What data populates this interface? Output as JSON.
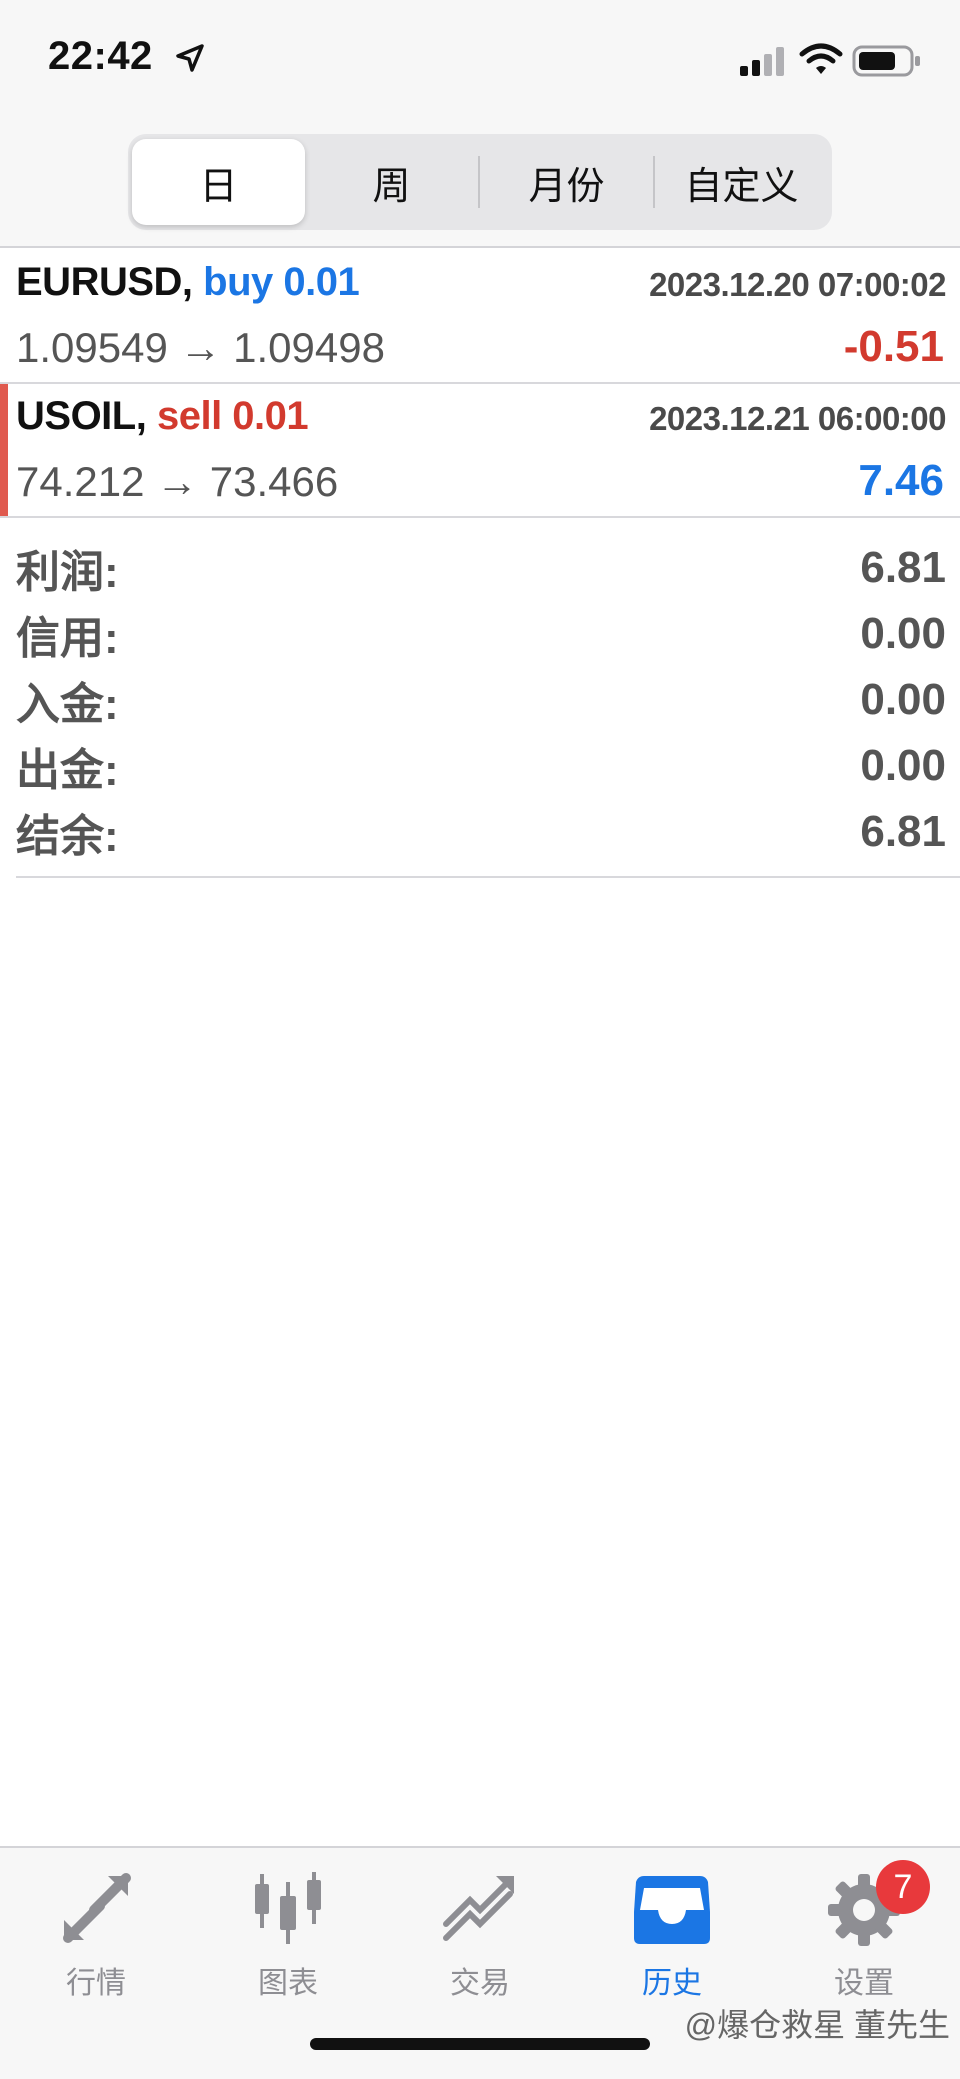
{
  "status_bar": {
    "time": "22:42"
  },
  "segments": [
    {
      "label": "日",
      "active": true
    },
    {
      "label": "周",
      "active": false
    },
    {
      "label": "月份",
      "active": false
    },
    {
      "label": "自定义",
      "active": false
    }
  ],
  "trades": [
    {
      "symbol": "EURUSD,",
      "side": "buy 0.01",
      "time": "2023.12.20 07:00:02",
      "prices": "1.09549 → 1.09498",
      "profit": "-0.51"
    },
    {
      "symbol": "USOIL,",
      "side": "sell 0.01",
      "time": "2023.12.21 06:00:00",
      "prices": "74.212 → 73.466",
      "profit": "7.46"
    }
  ],
  "summary": [
    {
      "label": "利润:",
      "value": "6.81"
    },
    {
      "label": "信用:",
      "value": "0.00"
    },
    {
      "label": "入金:",
      "value": "0.00"
    },
    {
      "label": "出金:",
      "value": "0.00"
    },
    {
      "label": "结余:",
      "value": "6.81"
    }
  ],
  "tabs": [
    {
      "label": "行情",
      "icon": "quotes-arrows-icon"
    },
    {
      "label": "图表",
      "icon": "candlestick-chart-icon"
    },
    {
      "label": "交易",
      "icon": "trade-trend-icon"
    },
    {
      "label": "历史",
      "icon": "history-inbox-icon",
      "active": true
    },
    {
      "label": "设置",
      "icon": "gear-icon",
      "badge": "7"
    }
  ],
  "watermark": "@爆仓救星 董先生",
  "colors": {
    "accent": "#1b76e4",
    "loss": "#d23a2e",
    "badge": "#e8393c"
  }
}
